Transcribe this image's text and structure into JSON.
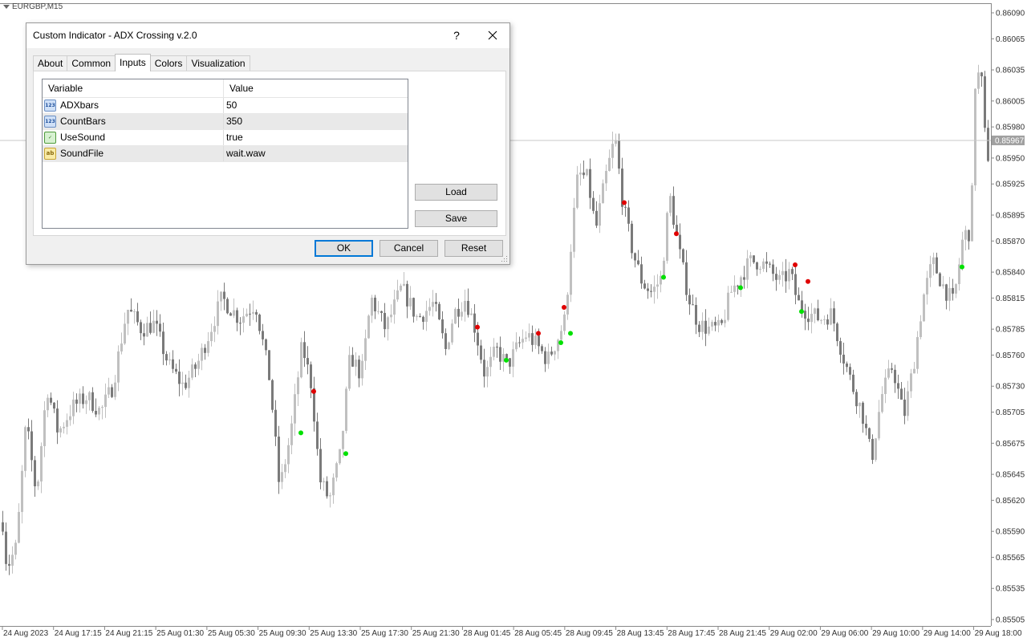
{
  "chart": {
    "symbol": "EURGBP,M15",
    "current_price": "0.85967",
    "price_ticks": [
      {
        "label": "0.86090",
        "value": 0.8609
      },
      {
        "label": "0.86065",
        "value": 0.86065
      },
      {
        "label": "0.86035",
        "value": 0.86035
      },
      {
        "label": "0.86005",
        "value": 0.86005
      },
      {
        "label": "0.85980",
        "value": 0.8598
      },
      {
        "label": "0.85950",
        "value": 0.8595
      },
      {
        "label": "0.85925",
        "value": 0.85925
      },
      {
        "label": "0.85895",
        "value": 0.85895
      },
      {
        "label": "0.85870",
        "value": 0.8587
      },
      {
        "label": "0.85840",
        "value": 0.8584
      },
      {
        "label": "0.85815",
        "value": 0.85815
      },
      {
        "label": "0.85785",
        "value": 0.85785
      },
      {
        "label": "0.85760",
        "value": 0.8576
      },
      {
        "label": "0.85730",
        "value": 0.8573
      },
      {
        "label": "0.85705",
        "value": 0.85705
      },
      {
        "label": "0.85675",
        "value": 0.85675
      },
      {
        "label": "0.85645",
        "value": 0.85645
      },
      {
        "label": "0.85620",
        "value": 0.8562
      },
      {
        "label": "0.85590",
        "value": 0.8559
      },
      {
        "label": "0.85565",
        "value": 0.85565
      },
      {
        "label": "0.85535",
        "value": 0.85535
      },
      {
        "label": "0.85505",
        "value": 0.85505
      }
    ],
    "time_labels": [
      "24 Aug 2023",
      "24 Aug 17:15",
      "24 Aug 21:15",
      "25 Aug 01:30",
      "25 Aug 05:30",
      "25 Aug 09:30",
      "25 Aug 13:30",
      "25 Aug 17:30",
      "25 Aug 21:30",
      "28 Aug 01:45",
      "28 Aug 05:45",
      "28 Aug 09:45",
      "28 Aug 13:45",
      "28 Aug 17:45",
      "28 Aug 21:45",
      "29 Aug 02:00",
      "29 Aug 06:00",
      "29 Aug 10:00",
      "29 Aug 14:00",
      "29 Aug 18:00"
    ],
    "colors": {
      "bull_candle": "#c0c0c0",
      "bear_candle": "#7a7a7a",
      "signal_up": "#00e000",
      "signal_down": "#e00000",
      "price_marker": "#a0a0a0"
    }
  },
  "chart_data": {
    "type": "candlestick",
    "symbol": "EURGBP,M15",
    "ylim": [
      0.85505,
      0.8609
    ],
    "path": [
      [
        0,
        0.85625
      ],
      [
        8,
        0.85555
      ],
      [
        20,
        0.85575
      ],
      [
        32,
        0.85695
      ],
      [
        45,
        0.85625
      ],
      [
        58,
        0.8573
      ],
      [
        72,
        0.85685
      ],
      [
        90,
        0.8571
      ],
      [
        108,
        0.8572
      ],
      [
        125,
        0.85705
      ],
      [
        140,
        0.8573
      ],
      [
        158,
        0.85805
      ],
      [
        176,
        0.85785
      ],
      [
        192,
        0.8579
      ],
      [
        210,
        0.8575
      ],
      [
        228,
        0.8573
      ],
      [
        245,
        0.8575
      ],
      [
        262,
        0.85785
      ],
      [
        276,
        0.85815
      ],
      [
        298,
        0.85795
      ],
      [
        318,
        0.8581
      ],
      [
        336,
        0.85735
      ],
      [
        348,
        0.8563
      ],
      [
        362,
        0.85685
      ],
      [
        376,
        0.8577
      ],
      [
        388,
        0.8573
      ],
      [
        398,
        0.8564
      ],
      [
        410,
        0.8562
      ],
      [
        424,
        0.85665
      ],
      [
        436,
        0.8576
      ],
      [
        450,
        0.8574
      ],
      [
        462,
        0.85815
      ],
      [
        480,
        0.85785
      ],
      [
        500,
        0.85825
      ],
      [
        520,
        0.85795
      ],
      [
        540,
        0.8581
      ],
      [
        555,
        0.85765
      ],
      [
        565,
        0.858
      ],
      [
        580,
        0.85815
      ],
      [
        592,
        0.85785
      ],
      [
        604,
        0.8574
      ],
      [
        618,
        0.85765
      ],
      [
        632,
        0.8575
      ],
      [
        646,
        0.8577
      ],
      [
        656,
        0.8578
      ],
      [
        668,
        0.8577
      ],
      [
        682,
        0.85755
      ],
      [
        694,
        0.85775
      ],
      [
        704,
        0.85795
      ],
      [
        712,
        0.85875
      ],
      [
        720,
        0.85935
      ],
      [
        732,
        0.8593
      ],
      [
        742,
        0.8588
      ],
      [
        754,
        0.8593
      ],
      [
        766,
        0.8597
      ],
      [
        776,
        0.85905
      ],
      [
        788,
        0.8586
      ],
      [
        800,
        0.8583
      ],
      [
        812,
        0.8582
      ],
      [
        824,
        0.85835
      ],
      [
        834,
        0.85915
      ],
      [
        846,
        0.8586
      ],
      [
        858,
        0.85815
      ],
      [
        870,
        0.8579
      ],
      [
        884,
        0.85785
      ],
      [
        898,
        0.85785
      ],
      [
        910,
        0.8582
      ],
      [
        922,
        0.85835
      ],
      [
        934,
        0.8585
      ],
      [
        948,
        0.8585
      ],
      [
        960,
        0.8584
      ],
      [
        972,
        0.8583
      ],
      [
        984,
        0.8584
      ],
      [
        994,
        0.8581
      ],
      [
        1008,
        0.858
      ],
      [
        1022,
        0.85795
      ],
      [
        1036,
        0.858
      ],
      [
        1050,
        0.8576
      ],
      [
        1062,
        0.8573
      ],
      [
        1074,
        0.85705
      ],
      [
        1086,
        0.8566
      ],
      [
        1098,
        0.8572
      ],
      [
        1112,
        0.8575
      ],
      [
        1126,
        0.857
      ],
      [
        1138,
        0.8575
      ],
      [
        1150,
        0.85815
      ],
      [
        1162,
        0.8585
      ],
      [
        1176,
        0.85825
      ],
      [
        1188,
        0.8581
      ],
      [
        1200,
        0.85875
      ],
      [
        1210,
        0.8588
      ],
      [
        1214,
        0.8602
      ],
      [
        1222,
        0.86035
      ],
      [
        1228,
        0.8596
      ],
      [
        1232,
        0.8595
      ]
    ],
    "signals_up": [
      [
        375,
        0.85685
      ],
      [
        431,
        0.85665
      ],
      [
        631,
        0.85755
      ],
      [
        699,
        0.85772
      ],
      [
        711,
        0.85781
      ],
      [
        827,
        0.85835
      ],
      [
        923,
        0.85825
      ],
      [
        999,
        0.85802
      ],
      [
        1199,
        0.85845
      ]
    ],
    "signals_down": [
      [
        391,
        0.85725
      ],
      [
        595,
        0.85787
      ],
      [
        671,
        0.85781
      ],
      [
        703,
        0.85806
      ],
      [
        778,
        0.85907
      ],
      [
        843,
        0.85877
      ],
      [
        991,
        0.85847
      ],
      [
        1007,
        0.85831
      ]
    ]
  },
  "dialog": {
    "title": "Custom Indicator - ADX Crossing v.2.0",
    "help_label": "?",
    "close_label": "✕",
    "tabs": [
      {
        "label": "About"
      },
      {
        "label": "Common"
      },
      {
        "label": "Inputs"
      },
      {
        "label": "Colors"
      },
      {
        "label": "Visualization"
      }
    ],
    "grid": {
      "col_variable": "Variable",
      "col_value": "Value",
      "rows": [
        {
          "icon_text": "123",
          "name": "ADXbars",
          "value": "50"
        },
        {
          "icon_text": "123",
          "name": "CountBars",
          "value": "350"
        },
        {
          "icon_text": "✓",
          "name": "UseSound",
          "value": "true"
        },
        {
          "icon_text": "ab",
          "name": "SoundFile",
          "value": "wait.waw"
        }
      ]
    },
    "load_label": "Load",
    "save_label": "Save",
    "ok_label": "OK",
    "cancel_label": "Cancel",
    "reset_label": "Reset"
  }
}
